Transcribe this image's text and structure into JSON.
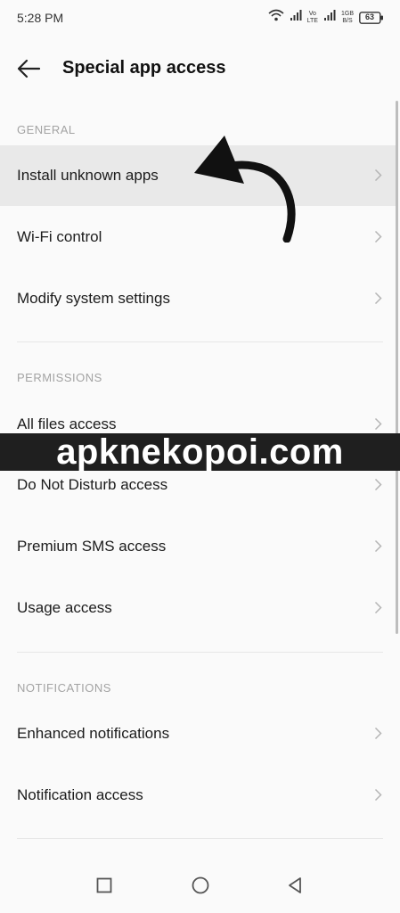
{
  "status_bar": {
    "time": "5:28 PM",
    "volte_top": "Vo",
    "volte_bottom": "LTE",
    "speed_top": "1GB",
    "speed_bottom": "B/S",
    "battery": "63",
    "icons": [
      "wifi-icon",
      "signal-icon",
      "signal-icon",
      "battery-icon"
    ]
  },
  "header": {
    "title": "Special app access",
    "back_icon": "arrow-left-icon"
  },
  "sections": [
    {
      "header": "GENERAL",
      "items": [
        {
          "label": "Install unknown apps",
          "highlighted": true
        },
        {
          "label": "Wi-Fi control"
        },
        {
          "label": "Modify system settings"
        }
      ]
    },
    {
      "header": "PERMISSIONS",
      "items": [
        {
          "label": "All files access"
        },
        {
          "label": "Do Not Disturb access"
        },
        {
          "label": "Premium SMS access"
        },
        {
          "label": "Usage access"
        }
      ]
    },
    {
      "header": "NOTIFICATIONS",
      "items": [
        {
          "label": "Enhanced notifications"
        },
        {
          "label": "Notification access"
        }
      ]
    }
  ],
  "watermark": "apknekopoi.com",
  "nav_bar": {
    "icons": [
      "recents-square-icon",
      "home-circle-icon",
      "back-triangle-icon"
    ]
  },
  "colors": {
    "background": "#fafafa",
    "highlight": "#e9e9e9",
    "section_header": "#a3a3a3",
    "watermark_bg": "#1f1f1f"
  }
}
